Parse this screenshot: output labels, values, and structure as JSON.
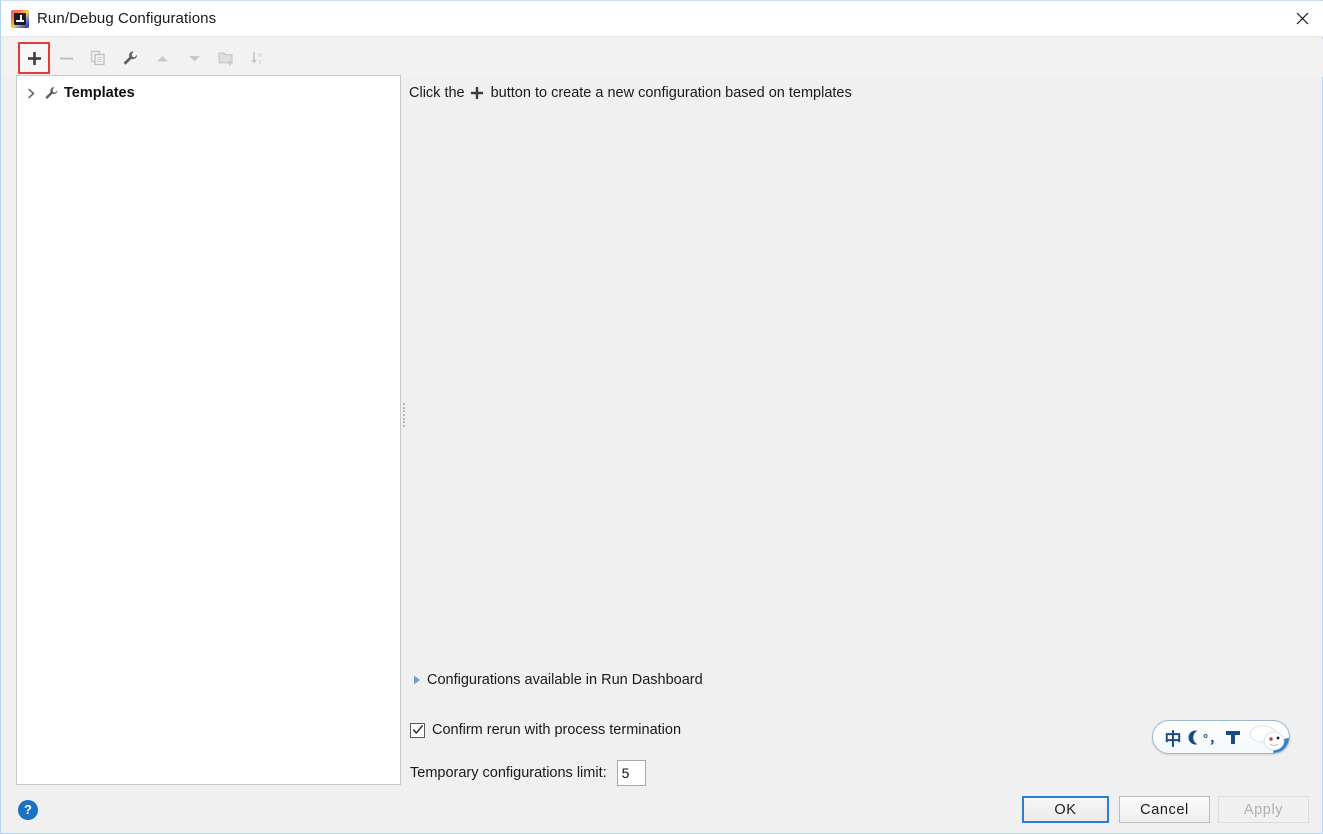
{
  "window": {
    "title": "Run/Debug Configurations",
    "app_icon": "intellij-idea-icon",
    "close_icon": "close-icon"
  },
  "toolbar": {
    "buttons": [
      {
        "name": "add-configuration-button",
        "icon": "plus-icon",
        "enabled": true,
        "highlighted": true
      },
      {
        "name": "remove-configuration-button",
        "icon": "minus-icon",
        "enabled": false,
        "highlighted": false
      },
      {
        "name": "copy-configuration-button",
        "icon": "copy-icon",
        "enabled": false,
        "highlighted": false
      },
      {
        "name": "edit-templates-button",
        "icon": "wrench-icon",
        "enabled": true,
        "highlighted": false
      },
      {
        "name": "move-up-button",
        "icon": "arrow-up-icon",
        "enabled": false,
        "highlighted": false
      },
      {
        "name": "move-down-button",
        "icon": "arrow-down-icon",
        "enabled": false,
        "highlighted": false
      },
      {
        "name": "new-folder-button",
        "icon": "folder-add-icon",
        "enabled": false,
        "highlighted": false
      },
      {
        "name": "sort-alphabetically-button",
        "icon": "sort-a-z-icon",
        "enabled": false,
        "highlighted": false
      }
    ]
  },
  "tree": {
    "items": [
      {
        "label": "Templates",
        "icon": "wrench-icon",
        "expanded": false,
        "chevron": "chevron-right-icon"
      }
    ]
  },
  "main": {
    "hint_prefix": "Click the",
    "hint_icon": "plus-icon",
    "hint_suffix": "button to create a new configuration based on templates",
    "dashboard_label": "Configurations available in Run Dashboard",
    "dashboard_triangle": "triangle-right-icon",
    "confirm_label": "Confirm rerun with process termination",
    "confirm_checked": true,
    "limit_label": "Temporary configurations limit:",
    "limit_value": "5"
  },
  "ime": {
    "language_mode": "中",
    "moon_icon": "crescent-moon-icon",
    "punctuation": "°，",
    "keyboard_icon": "soft-keyboard-icon",
    "logo_icon": "sogou-logo-icon"
  },
  "footer": {
    "help_label": "?",
    "ok_label": "OK",
    "cancel_label": "Cancel",
    "apply_label": "Apply",
    "apply_enabled": false
  },
  "colors": {
    "accent_focus": "#2a7fd4",
    "highlight_box": "#e33b3b",
    "panel_bg": "#f0f0f0",
    "field_bg": "#ffffff",
    "help_blue": "#1b72c4",
    "triangle_blue": "#7a9cc0"
  }
}
